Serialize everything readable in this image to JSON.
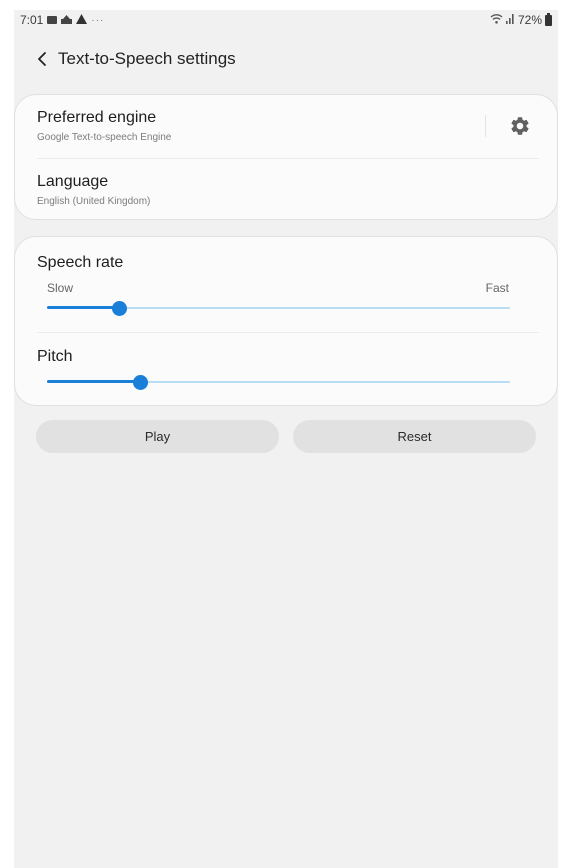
{
  "status_bar": {
    "time": "7:01",
    "overflow": "···",
    "battery": "72%",
    "left_icons": [
      "gallery-icon",
      "cast-icon",
      "alert-icon"
    ],
    "right_icons": [
      "wifi-icon",
      "signal-icon",
      "battery-icon"
    ]
  },
  "header": {
    "title": "Text-to-Speech settings",
    "back_icon": "chevron-left-icon"
  },
  "engine_card": {
    "preferred_engine": {
      "title": "Preferred engine",
      "value": "Google Text-to-speech Engine",
      "settings_icon": "gear-icon"
    },
    "language": {
      "title": "Language",
      "value": "English (United Kingdom)"
    }
  },
  "speech_card": {
    "speech_rate": {
      "title": "Speech rate",
      "min_label": "Slow",
      "max_label": "Fast",
      "level": 0.155
    },
    "pitch": {
      "title": "Pitch",
      "level": 0.2
    }
  },
  "buttons": {
    "play": "Play",
    "reset": "Reset"
  },
  "colors": {
    "accent": "#1a7fd8",
    "track": "#b9ddf3",
    "background": "#f1f1f1",
    "card": "#fbfbfb",
    "button": "#e1e1e1"
  }
}
